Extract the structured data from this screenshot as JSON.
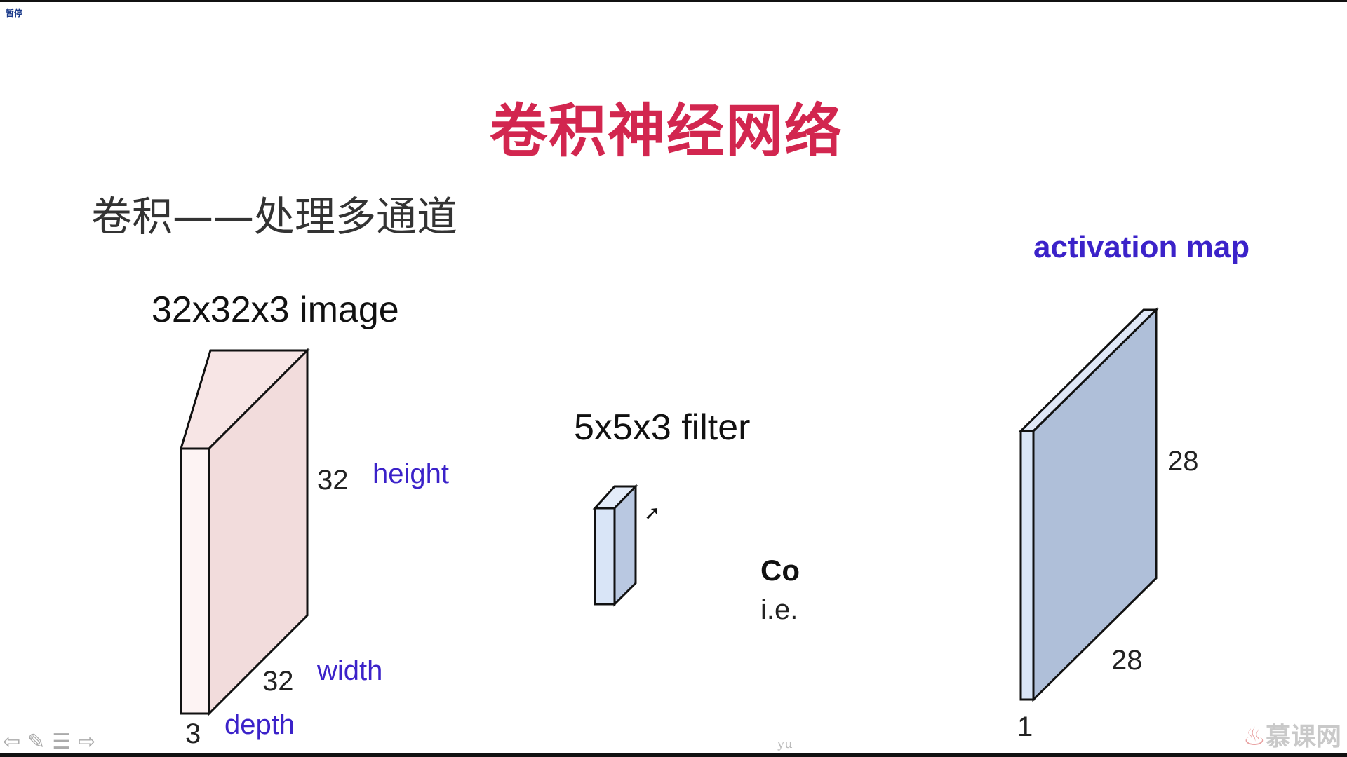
{
  "player": {
    "pause_label": "暂停"
  },
  "slide": {
    "title": "卷积神经网络",
    "subtitle": "卷积——处理多通道",
    "image_label": "32x32x3 image",
    "image_height_num": "32",
    "image_height_word": "height",
    "image_width_num": "32",
    "image_width_word": "width",
    "image_depth_num": "3",
    "image_depth_word": "depth",
    "filter_label": "5x5x3 filter",
    "conv_text_partial": "Co",
    "conv_text_sub": "i.e.",
    "activation_label": "activation map",
    "act_height_num": "28",
    "act_width_num": "28",
    "act_depth_num": "1"
  },
  "footer": {
    "watermark": "yu",
    "logo_text": "慕课网"
  },
  "colors": {
    "title": "#d2264f",
    "accent_purple": "#3b22c9",
    "image_face": "#f2dcdc",
    "filter_face": "#d9e5f7",
    "activation_face": "#afbfd9"
  },
  "icons": [
    "back-arrow-icon",
    "pen-icon",
    "menu-icon",
    "forward-arrow-icon",
    "cursor-icon",
    "flame-icon"
  ]
}
